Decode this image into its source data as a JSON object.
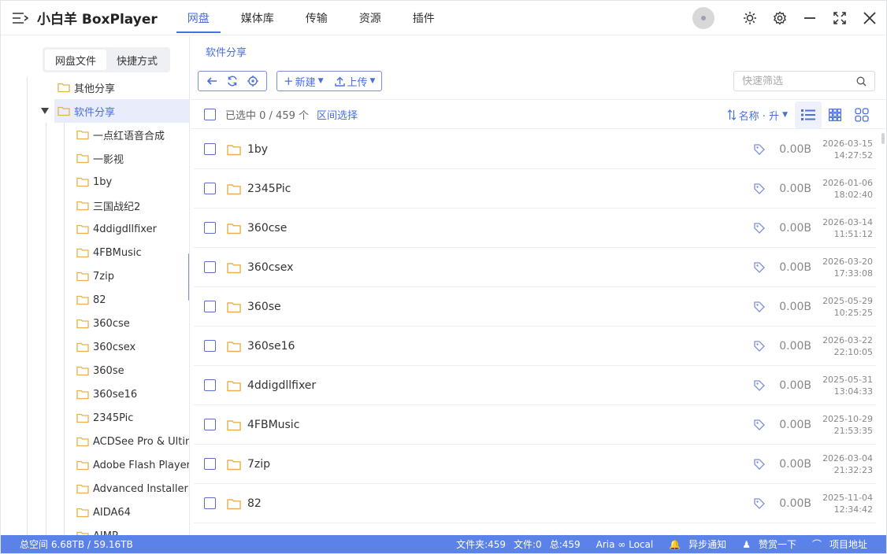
{
  "app": {
    "title": "小白羊 BoxPlayer"
  },
  "nav": {
    "items": [
      "网盘",
      "媒体库",
      "传输",
      "资源",
      "插件"
    ],
    "active": "网盘"
  },
  "sidebar": {
    "tabs": [
      "网盘文件",
      "快捷方式"
    ],
    "tree": [
      {
        "label": "其他分享"
      },
      {
        "label": "软件分享",
        "selected": true
      },
      {
        "label": "一点红语音合成"
      },
      {
        "label": "一影视"
      },
      {
        "label": "1by"
      },
      {
        "label": "三国战纪2"
      },
      {
        "label": "4ddigdllfixer"
      },
      {
        "label": "4FBMusic"
      },
      {
        "label": "7zip"
      },
      {
        "label": "82"
      },
      {
        "label": "360cse"
      },
      {
        "label": "360csex"
      },
      {
        "label": "360se"
      },
      {
        "label": "360se16"
      },
      {
        "label": "2345Pic"
      },
      {
        "label": "ACDSee Pro & Ultim"
      },
      {
        "label": "Adobe Flash Player"
      },
      {
        "label": "Advanced Installer"
      },
      {
        "label": "AIDA64"
      },
      {
        "label": "AIMP"
      }
    ]
  },
  "main": {
    "breadcrumb": "软件分享",
    "toolbar": {
      "new_label": "新建",
      "upload_label": "上传",
      "filter_placeholder": "快速筛选"
    },
    "list_header": {
      "selected_text": "已选中 0 / 459 个",
      "range_select": "区间选择",
      "sort_label": "名称 · 升"
    },
    "files": [
      {
        "name": "1by",
        "size": "0.00B",
        "date": "2026-03-15",
        "time": "14:27:52"
      },
      {
        "name": "2345Pic",
        "size": "0.00B",
        "date": "2026-01-06",
        "time": "18:02:40"
      },
      {
        "name": "360cse",
        "size": "0.00B",
        "date": "2026-03-14",
        "time": "11:51:12"
      },
      {
        "name": "360csex",
        "size": "0.00B",
        "date": "2026-03-20",
        "time": "17:33:08"
      },
      {
        "name": "360se",
        "size": "0.00B",
        "date": "2025-05-29",
        "time": "10:25:25"
      },
      {
        "name": "360se16",
        "size": "0.00B",
        "date": "2026-03-22",
        "time": "22:10:05"
      },
      {
        "name": "4ddigdllfixer",
        "size": "0.00B",
        "date": "2025-05-31",
        "time": "13:04:33"
      },
      {
        "name": "4FBMusic",
        "size": "0.00B",
        "date": "2025-10-29",
        "time": "21:53:35"
      },
      {
        "name": "7zip",
        "size": "0.00B",
        "date": "2026-03-04",
        "time": "21:32:23"
      },
      {
        "name": "82",
        "size": "0.00B",
        "date": "2025-11-04",
        "time": "12:34:42"
      }
    ]
  },
  "status": {
    "space": "总空间 6.68TB / 59.16TB",
    "folders": "文件夹:459",
    "files": "文件:0",
    "total": "总:459",
    "aria": "Aria ∞ Local",
    "notify": "异步通知",
    "donate": "赞赏一下",
    "project": "项目地址"
  },
  "colors": {
    "accent": "#4a6ee0",
    "statusbar": "#5b82e8",
    "folder": "#e8b04a"
  }
}
